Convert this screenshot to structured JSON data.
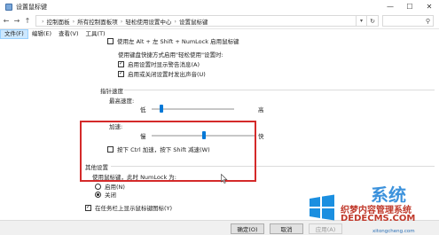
{
  "window": {
    "title": "设置鼠标键",
    "minimize": "—",
    "maximize": "☐",
    "close": "✕"
  },
  "address": {
    "back": "←",
    "forward": "→",
    "up": "↑",
    "crumbs": [
      "控制面板",
      "所有控制面板项",
      "轻松使用设置中心",
      "设置鼠标键"
    ],
    "sep": "›",
    "refresh": "↻",
    "search_icon": "⚲"
  },
  "menu": {
    "items": [
      "文件(F)",
      "编辑(E)",
      "查看(V)",
      "工具(T)"
    ]
  },
  "keyboard_shortcut": {
    "enable_label": "使用左 Alt + 左 Shift + NumLock 启用鼠标键",
    "when_using_label": "使用键盘快捷方式启用\"轻松使用\"设置时:",
    "warning_label": "启用设置时显示警告消息(A)",
    "sound_label": "启用或关闭设置时发出声音(U)"
  },
  "pointer_speed": {
    "heading": "指针速度",
    "max_speed_label": "最高速度:",
    "max_low": "低",
    "max_high": "高",
    "max_speed_value": 0.12,
    "accel_label": "加速:",
    "accel_slow": "慢",
    "accel_fast": "快",
    "accel_value": 0.5,
    "ctrl_shift_label": "按下 Ctrl 加速，按下 Shift 减速(W)"
  },
  "other": {
    "heading": "其他设置",
    "numlock_label": "使用鼠标键，此时 NumLock 为:",
    "on_label": "启用(N)",
    "off_label": "关闭",
    "taskbar_label": "在任务栏上显示鼠标键图标(Y)"
  },
  "buttons": {
    "ok": "确定(O)",
    "cancel": "取消",
    "apply": "应用(A)"
  },
  "watermark": {
    "brand_big": "系统",
    "line1": "织梦内容管理系统",
    "line2": "DEDECMS.COM",
    "line3": "xitongcheng.com"
  },
  "colors": {
    "highlight": "#d42a2a",
    "slider_thumb": "#0078d7"
  }
}
